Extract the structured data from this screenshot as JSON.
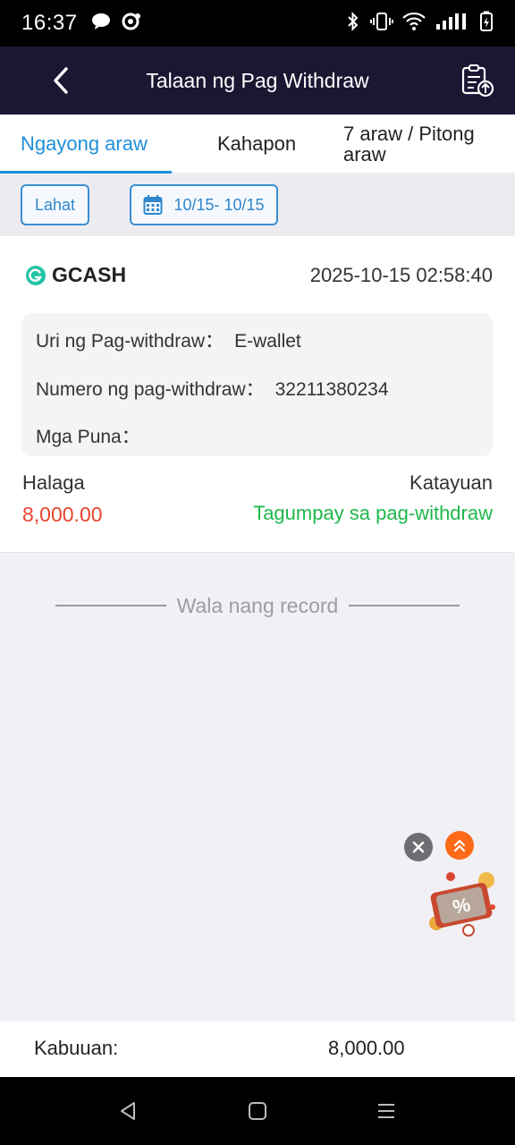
{
  "status_bar": {
    "time": "16:37",
    "left_icons": [
      "chat-bubble-icon",
      "notification-app-icon"
    ],
    "right_icons": [
      "bluetooth-icon",
      "vibrate-icon",
      "wifi-icon",
      "signal-icon",
      "battery-charging-icon"
    ]
  },
  "header": {
    "title": "Talaan ng Pag Withdraw",
    "back_icon": "chevron-left-icon",
    "action_icon": "clipboard-upload-icon"
  },
  "tabs": [
    {
      "label": "Ngayong araw",
      "active": true
    },
    {
      "label": "Kahapon",
      "active": false
    },
    {
      "label": "7 araw / Pitong araw",
      "active": false
    }
  ],
  "filters": {
    "all_label": "Lahat",
    "date_range": "10/15- 10/15",
    "calendar_icon": "calendar-icon"
  },
  "record": {
    "method": "GCASH",
    "method_icon": "gcash-logo-icon",
    "datetime": "2025-10-15 02:58:40",
    "details": [
      {
        "label": "Uri ng Pag-withdraw：",
        "value": "E-wallet"
      },
      {
        "label": "Numero ng pag-withdraw：",
        "value": "32211380234"
      },
      {
        "label": "Mga Puna：",
        "value": ""
      }
    ],
    "amount_label": "Halaga",
    "amount": "8,000.00",
    "status_label": "Katayuan",
    "status": "Tagumpay sa pag-withdraw"
  },
  "no_more": "Wala nang record",
  "floating": {
    "close_icon": "close-icon",
    "up_icon": "double-chevron-up-icon",
    "promo_icon": "discount-coupon-icon"
  },
  "total": {
    "label": "Kabuuan:",
    "value": "8,000.00"
  },
  "nav": {
    "back_icon": "nav-back-icon",
    "home_icon": "nav-home-icon",
    "menu_icon": "nav-menu-icon"
  },
  "colors": {
    "header_bg": "#1b1733",
    "accent": "#1e8fd9",
    "amount": "#e8442d",
    "success": "#1fb84b"
  }
}
